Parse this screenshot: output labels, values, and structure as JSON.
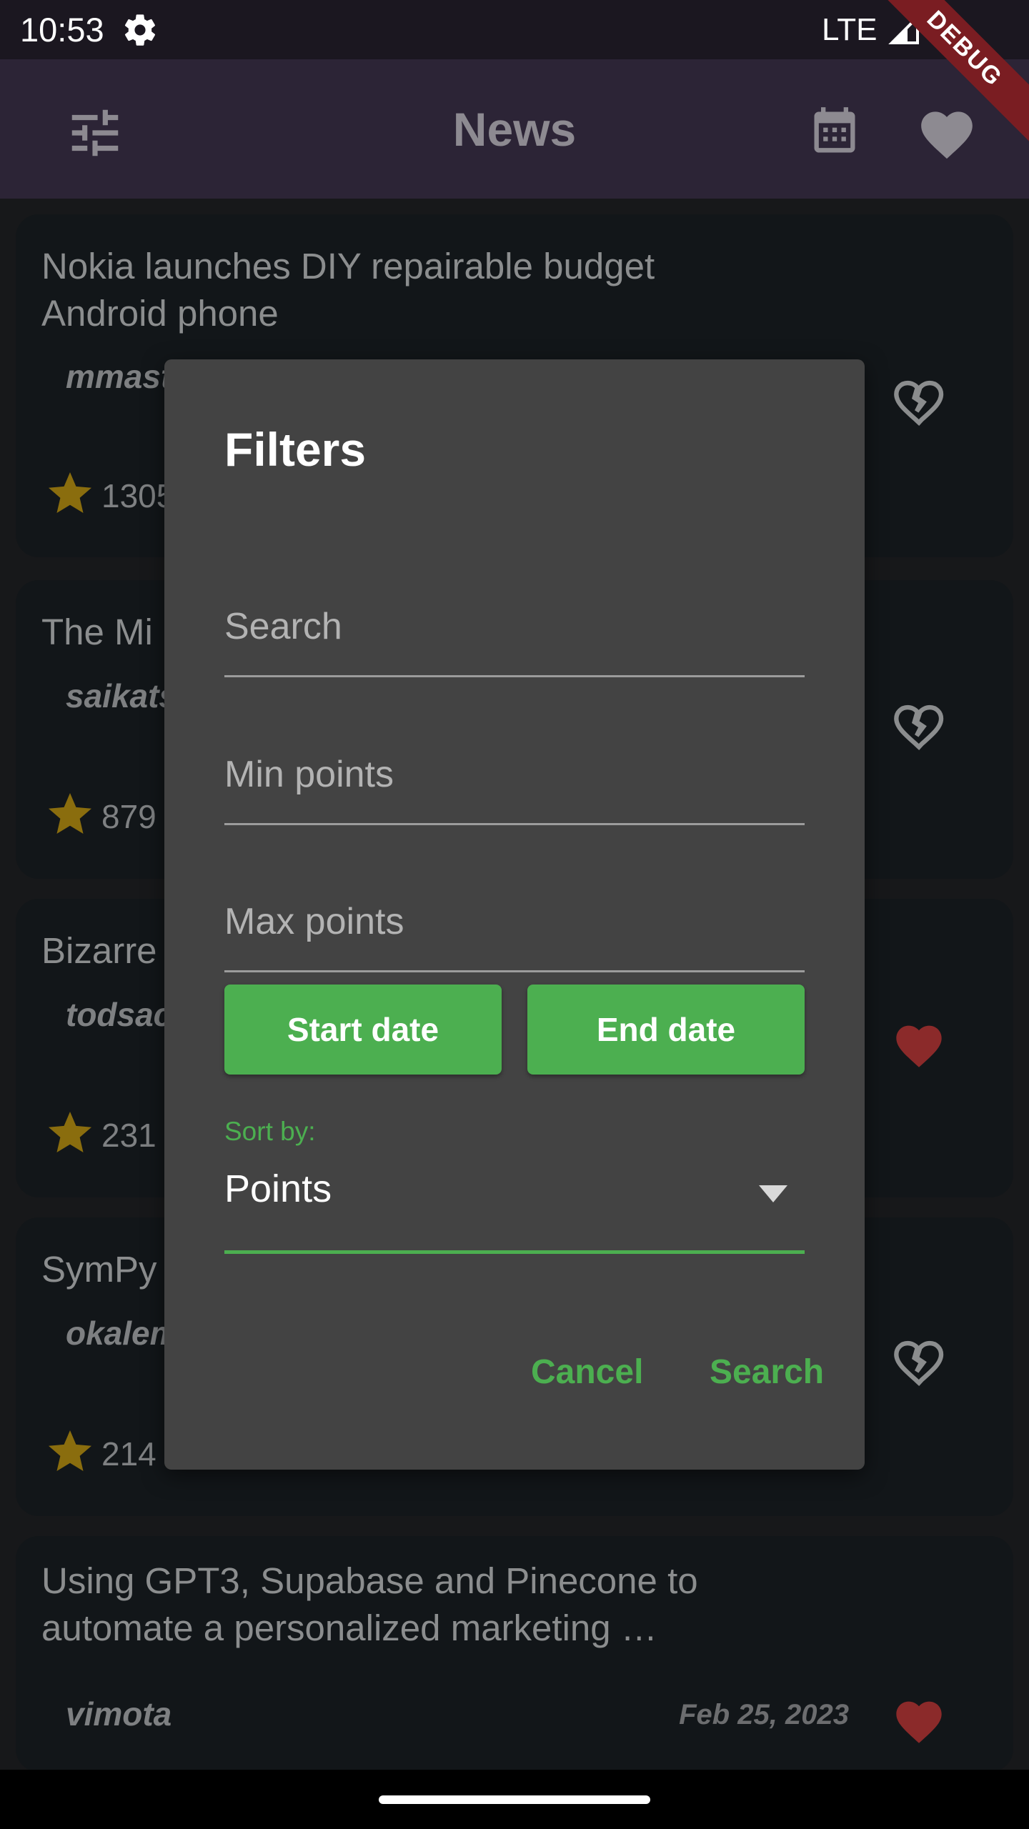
{
  "status_bar": {
    "time": "10:53",
    "network": "LTE"
  },
  "debug_banner": "DEBUG",
  "app_bar": {
    "title": "News"
  },
  "articles": [
    {
      "title": "Nokia launches DIY repairable budget Android phone",
      "author": "mmast",
      "points": "1305",
      "favorite": false
    },
    {
      "title": "The Mi",
      "author": "saikats",
      "points": "879",
      "favorite": false
    },
    {
      "title": "Bizarre",
      "author": "todsac",
      "points": "231",
      "favorite": true
    },
    {
      "title": "SymPy",
      "author": "okalem",
      "points": "214",
      "favorite": false
    },
    {
      "title": "Using GPT3, Supabase and Pinecone to automate a personalized marketing …",
      "author": "vimota",
      "date": "Feb 25, 2023",
      "favorite": true
    }
  ],
  "dialog": {
    "title": "Filters",
    "search_placeholder": "Search",
    "min_points_placeholder": "Min points",
    "max_points_placeholder": "Max points",
    "start_date_label": "Start date",
    "end_date_label": "End date",
    "sort_label": "Sort by:",
    "sort_value": "Points",
    "cancel_label": "Cancel",
    "search_label": "Search"
  },
  "colors": {
    "accent": "#4caf50",
    "app_bar": "#2c2436",
    "dialog": "#434343",
    "favorite": "#8b2a2a",
    "star": "#8a6d0e"
  }
}
